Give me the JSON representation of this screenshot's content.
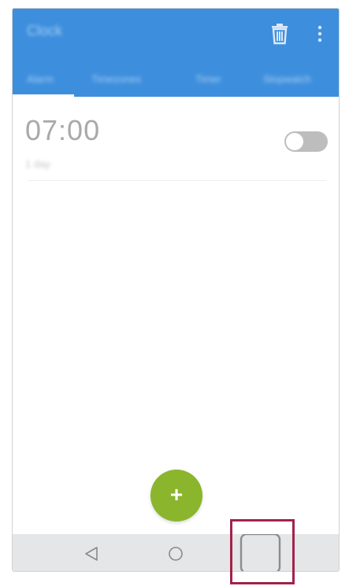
{
  "app_bar": {
    "title": "Clock",
    "tabs": [
      {
        "label": "Alarm",
        "selected": true
      },
      {
        "label": "Timezones",
        "selected": false
      },
      {
        "label": "Timer",
        "selected": false
      },
      {
        "label": "Stopwatch",
        "selected": false
      }
    ],
    "actions": {
      "delete_icon": "trash-icon",
      "more_icon": "more-vert-icon"
    }
  },
  "alarms": [
    {
      "time": "07:00",
      "subtitle": "1 day",
      "enabled": false
    }
  ],
  "fab": {
    "label": "+",
    "icon": "add-icon"
  },
  "nav_bar": {
    "back_icon": "back-triangle-icon",
    "home_icon": "home-circle-icon",
    "recents_icon": "recents-square-icon"
  },
  "colors": {
    "app_bar": "#3d8fde",
    "fab": "#8ab52d",
    "nav_bar": "#e4e6e8",
    "highlight": "#a2234a",
    "toggle_off": "#bdbdbd"
  }
}
